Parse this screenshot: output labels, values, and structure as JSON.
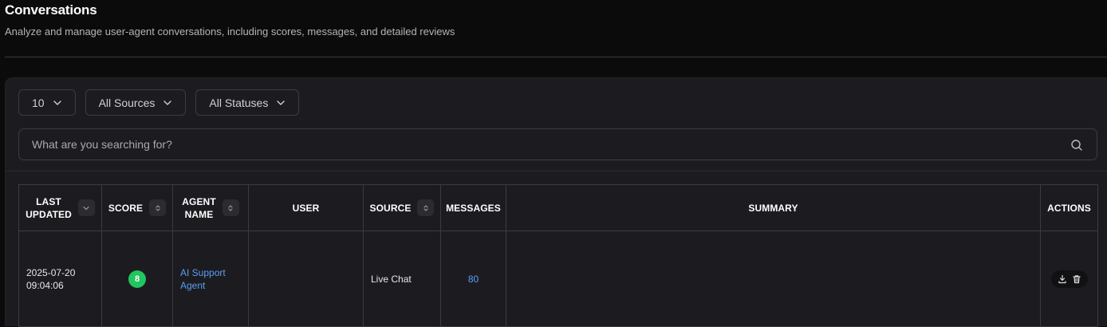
{
  "page": {
    "title": "Conversations",
    "subtitle": "Analyze and manage user-agent conversations, including scores, messages, and detailed reviews"
  },
  "filters": {
    "page_size": "10",
    "source": "All Sources",
    "status": "All Statuses"
  },
  "search": {
    "placeholder": "What are you searching for?",
    "icon": "search-icon"
  },
  "table": {
    "headers": {
      "last_updated_line1": "LAST",
      "last_updated_line2": "UPDATED",
      "score": "SCORE",
      "agent_name_line1": "AGENT",
      "agent_name_line2": "NAME",
      "user": "USER",
      "source": "SOURCE",
      "messages": "MESSAGES",
      "summary": "SUMMARY",
      "actions": "ACTIONS"
    },
    "rows": [
      {
        "date": "2025-07-20",
        "time": "09:04:06",
        "score": "8",
        "score_color": "#22c55e",
        "agent_line1": "AI Support",
        "agent_line2": "Agent",
        "user": "",
        "source": "Live Chat",
        "messages": "80",
        "summary": ""
      }
    ]
  },
  "colors": {
    "accent_link": "#5b9cf6",
    "score_good": "#22c55e",
    "panel_bg": "#1c1c20",
    "page_bg": "#0b0b0c"
  }
}
